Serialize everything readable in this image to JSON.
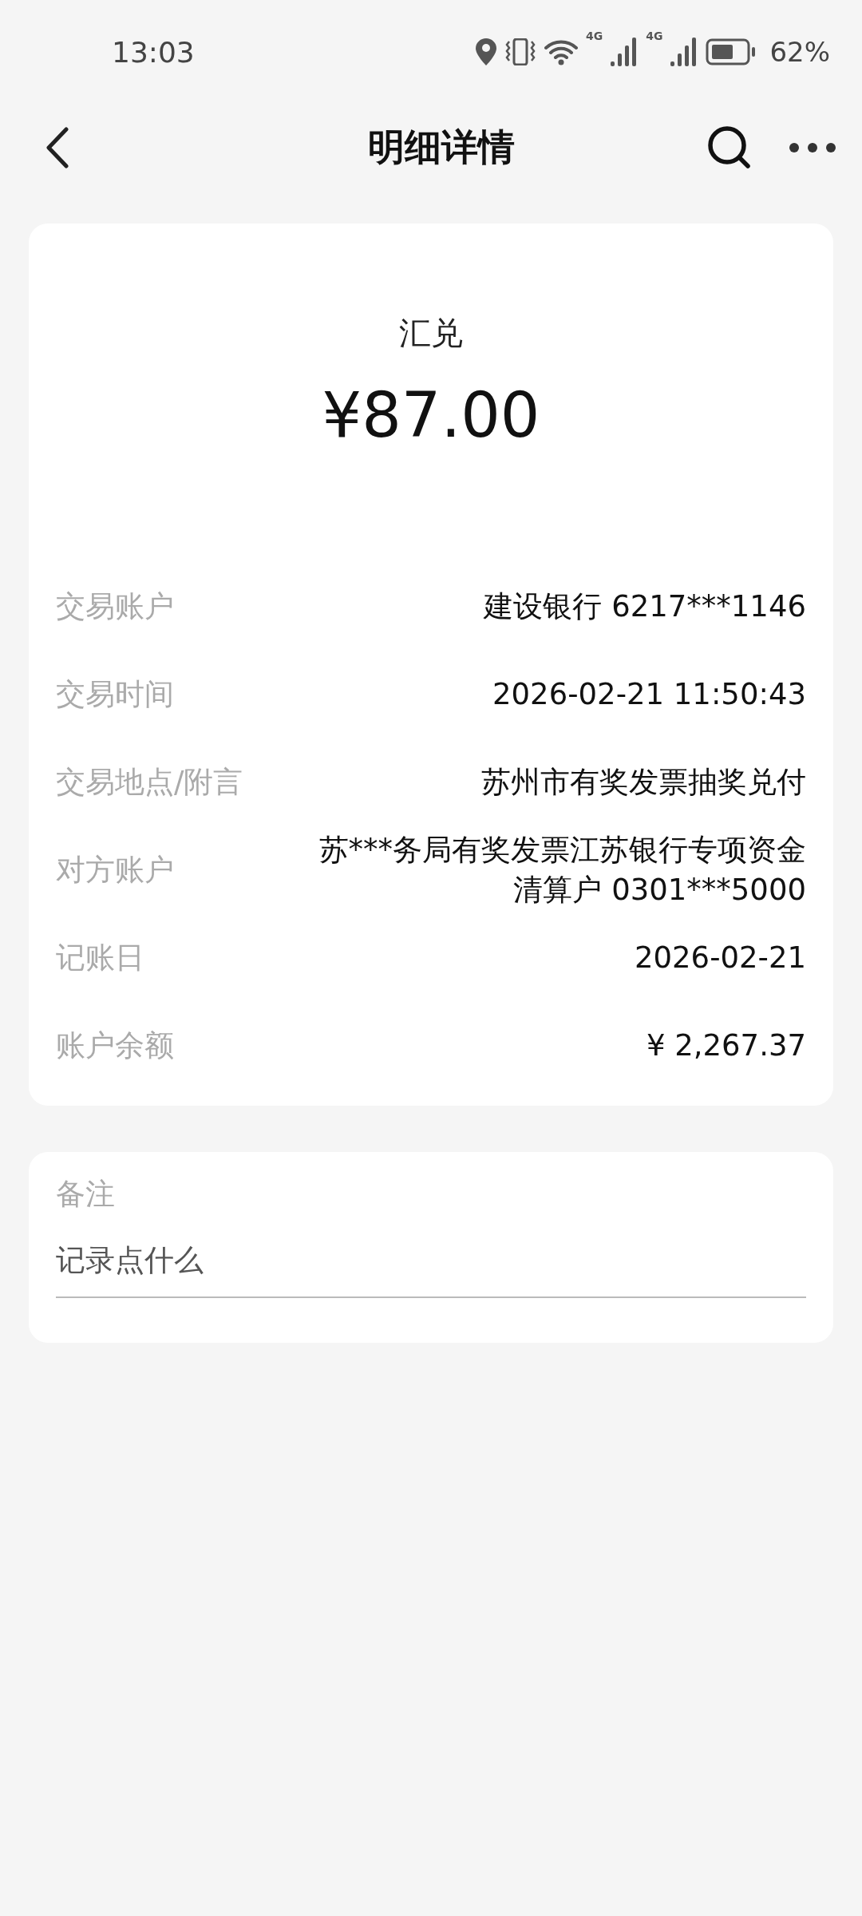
{
  "status_bar": {
    "time": "13:03",
    "network_1": "4G",
    "network_2": "4G",
    "battery": "62%"
  },
  "nav": {
    "title": "明细详情"
  },
  "summary": {
    "type": "汇兑",
    "amount": "¥87.00"
  },
  "details": [
    {
      "label": "交易账户",
      "value": "建设银行 6217***1146"
    },
    {
      "label": "交易时间",
      "value": "2026-02-21 11:50:43"
    },
    {
      "label": "交易地点/附言",
      "value": "苏州市有奖发票抽奖兑付"
    },
    {
      "label": "对方账户",
      "value": "苏***务局有奖发票江苏银行专项资金清算户 0301***5000"
    },
    {
      "label": "记账日",
      "value": "2026-02-21"
    },
    {
      "label": "账户余额",
      "value": "¥ 2,267.37"
    }
  ],
  "note": {
    "label": "备注",
    "placeholder": "记录点什么"
  }
}
